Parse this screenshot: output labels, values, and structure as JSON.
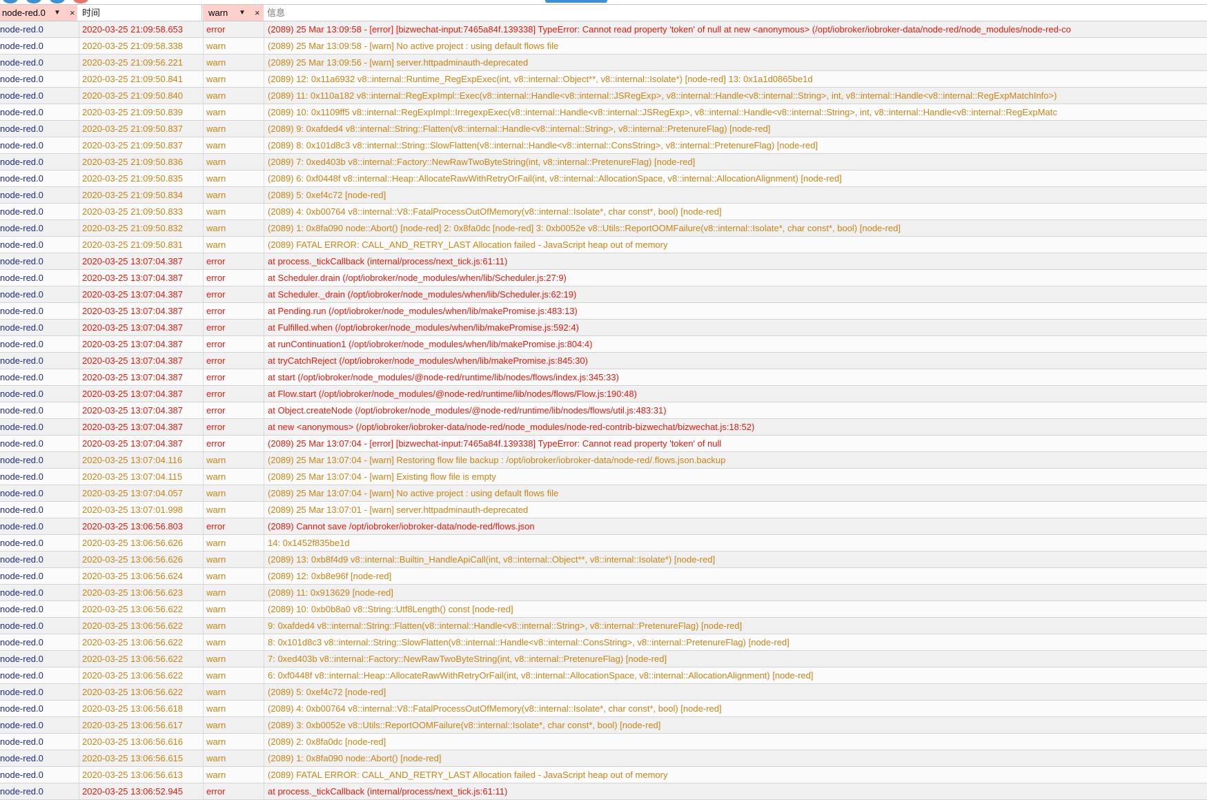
{
  "colors": {
    "warn": "#c98515",
    "error": "#e51b0e",
    "source": "#1f2a8a",
    "filter_bg": "#fdd0cc"
  },
  "filters": {
    "source": {
      "value": "node-red.0",
      "caret": "▼",
      "clear": "×"
    },
    "time": {
      "value": "时间"
    },
    "severity": {
      "value": "warn",
      "caret": "▼",
      "clear": "×"
    },
    "message": {
      "placeholder": "信息"
    }
  },
  "log_rows": [
    {
      "source": "node-red.0",
      "time": "2020-03-25 21:09:58.653",
      "severity": "error",
      "message": "(2089) 25 Mar 13:09:58 - [error] [bizwechat-input:7465a84f.139338] TypeError: Cannot read property 'token' of null at new <anonymous> (/opt/iobroker/iobroker-data/node-red/node_modules/node-red-co"
    },
    {
      "source": "node-red.0",
      "time": "2020-03-25 21:09:58.338",
      "severity": "warn",
      "message": "(2089) 25 Mar 13:09:58 - [warn] No active project : using default flows file"
    },
    {
      "source": "node-red.0",
      "time": "2020-03-25 21:09:56.221",
      "severity": "warn",
      "message": "(2089) 25 Mar 13:09:56 - [warn] server.httpadminauth-deprecated"
    },
    {
      "source": "node-red.0",
      "time": "2020-03-25 21:09:50.841",
      "severity": "warn",
      "message": "(2089) 12: 0x11a6932 v8::internal::Runtime_RegExpExec(int, v8::internal::Object**, v8::internal::Isolate*) [node-red] 13: 0x1a1d0865be1d"
    },
    {
      "source": "node-red.0",
      "time": "2020-03-25 21:09:50.840",
      "severity": "warn",
      "message": "(2089) 11: 0x110a182 v8::internal::RegExpImpl::Exec(v8::internal::Handle<v8::internal::JSRegExp>, v8::internal::Handle<v8::internal::String>, int, v8::internal::Handle<v8::internal::RegExpMatchInfo>)"
    },
    {
      "source": "node-red.0",
      "time": "2020-03-25 21:09:50.839",
      "severity": "warn",
      "message": "(2089) 10: 0x1109ff5 v8::internal::RegExpImpl::IrregexpExec(v8::internal::Handle<v8::internal::JSRegExp>, v8::internal::Handle<v8::internal::String>, int, v8::internal::Handle<v8::internal::RegExpMatc"
    },
    {
      "source": "node-red.0",
      "time": "2020-03-25 21:09:50.837",
      "severity": "warn",
      "message": "(2089) 9: 0xafded4 v8::internal::String::Flatten(v8::internal::Handle<v8::internal::String>, v8::internal::PretenureFlag) [node-red]"
    },
    {
      "source": "node-red.0",
      "time": "2020-03-25 21:09:50.837",
      "severity": "warn",
      "message": "(2089) 8: 0x101d8c3 v8::internal::String::SlowFlatten(v8::internal::Handle<v8::internal::ConsString>, v8::internal::PretenureFlag) [node-red]"
    },
    {
      "source": "node-red.0",
      "time": "2020-03-25 21:09:50.836",
      "severity": "warn",
      "message": "(2089) 7: 0xed403b v8::internal::Factory::NewRawTwoByteString(int, v8::internal::PretenureFlag) [node-red]"
    },
    {
      "source": "node-red.0",
      "time": "2020-03-25 21:09:50.835",
      "severity": "warn",
      "message": "(2089) 6: 0xf0448f v8::internal::Heap::AllocateRawWithRetryOrFail(int, v8::internal::AllocationSpace, v8::internal::AllocationAlignment) [node-red]"
    },
    {
      "source": "node-red.0",
      "time": "2020-03-25 21:09:50.834",
      "severity": "warn",
      "message": "(2089) 5: 0xef4c72 [node-red]"
    },
    {
      "source": "node-red.0",
      "time": "2020-03-25 21:09:50.833",
      "severity": "warn",
      "message": "(2089) 4: 0xb00764 v8::internal::V8::FatalProcessOutOfMemory(v8::internal::Isolate*, char const*, bool) [node-red]"
    },
    {
      "source": "node-red.0",
      "time": "2020-03-25 21:09:50.832",
      "severity": "warn",
      "message": "(2089) 1: 0x8fa090 node::Abort() [node-red] 2: 0x8fa0dc [node-red] 3: 0xb0052e v8::Utils::ReportOOMFailure(v8::internal::Isolate*, char const*, bool) [node-red]"
    },
    {
      "source": "node-red.0",
      "time": "2020-03-25 21:09:50.831",
      "severity": "warn",
      "message": "(2089) FATAL ERROR: CALL_AND_RETRY_LAST Allocation failed - JavaScript heap out of memory"
    },
    {
      "source": "node-red.0",
      "time": "2020-03-25 13:07:04.387",
      "severity": "error",
      "message": "at process._tickCallback (internal/process/next_tick.js:61:11)"
    },
    {
      "source": "node-red.0",
      "time": "2020-03-25 13:07:04.387",
      "severity": "error",
      "message": "at Scheduler.drain (/opt/iobroker/node_modules/when/lib/Scheduler.js:27:9)"
    },
    {
      "source": "node-red.0",
      "time": "2020-03-25 13:07:04.387",
      "severity": "error",
      "message": "at Scheduler._drain (/opt/iobroker/node_modules/when/lib/Scheduler.js:62:19)"
    },
    {
      "source": "node-red.0",
      "time": "2020-03-25 13:07:04.387",
      "severity": "error",
      "message": "at Pending.run (/opt/iobroker/node_modules/when/lib/makePromise.js:483:13)"
    },
    {
      "source": "node-red.0",
      "time": "2020-03-25 13:07:04.387",
      "severity": "error",
      "message": "at Fulfilled.when (/opt/iobroker/node_modules/when/lib/makePromise.js:592:4)"
    },
    {
      "source": "node-red.0",
      "time": "2020-03-25 13:07:04.387",
      "severity": "error",
      "message": "at runContinuation1 (/opt/iobroker/node_modules/when/lib/makePromise.js:804:4)"
    },
    {
      "source": "node-red.0",
      "time": "2020-03-25 13:07:04.387",
      "severity": "error",
      "message": "at tryCatchReject (/opt/iobroker/node_modules/when/lib/makePromise.js:845:30)"
    },
    {
      "source": "node-red.0",
      "time": "2020-03-25 13:07:04.387",
      "severity": "error",
      "message": "at start (/opt/iobroker/node_modules/@node-red/runtime/lib/nodes/flows/index.js:345:33)"
    },
    {
      "source": "node-red.0",
      "time": "2020-03-25 13:07:04.387",
      "severity": "error",
      "message": "at Flow.start (/opt/iobroker/node_modules/@node-red/runtime/lib/nodes/flows/Flow.js:190:48)"
    },
    {
      "source": "node-red.0",
      "time": "2020-03-25 13:07:04.387",
      "severity": "error",
      "message": "at Object.createNode (/opt/iobroker/node_modules/@node-red/runtime/lib/nodes/flows/util.js:483:31)"
    },
    {
      "source": "node-red.0",
      "time": "2020-03-25 13:07:04.387",
      "severity": "error",
      "message": "at new <anonymous> (/opt/iobroker/iobroker-data/node-red/node_modules/node-red-contrib-bizwechat/bizwechat.js:18:52)"
    },
    {
      "source": "node-red.0",
      "time": "2020-03-25 13:07:04.387",
      "severity": "error",
      "message": "(2089) 25 Mar 13:07:04 - [error] [bizwechat-input:7465a84f.139338] TypeError: Cannot read property 'token' of null"
    },
    {
      "source": "node-red.0",
      "time": "2020-03-25 13:07:04.116",
      "severity": "warn",
      "message": "(2089) 25 Mar 13:07:04 - [warn] Restoring flow file backup : /opt/iobroker/iobroker-data/node-red/.flows.json.backup"
    },
    {
      "source": "node-red.0",
      "time": "2020-03-25 13:07:04.115",
      "severity": "warn",
      "message": "(2089) 25 Mar 13:07:04 - [warn] Existing flow file is empty"
    },
    {
      "source": "node-red.0",
      "time": "2020-03-25 13:07:04.057",
      "severity": "warn",
      "message": "(2089) 25 Mar 13:07:04 - [warn] No active project : using default flows file"
    },
    {
      "source": "node-red.0",
      "time": "2020-03-25 13:07:01.998",
      "severity": "warn",
      "message": "(2089) 25 Mar 13:07:01 - [warn] server.httpadminauth-deprecated"
    },
    {
      "source": "node-red.0",
      "time": "2020-03-25 13:06:56.803",
      "severity": "error",
      "message": "(2089) Cannot save /opt/iobroker/iobroker-data/node-red/flows.json"
    },
    {
      "source": "node-red.0",
      "time": "2020-03-25 13:06:56.626",
      "severity": "warn",
      "message": "14: 0x1452f835be1d"
    },
    {
      "source": "node-red.0",
      "time": "2020-03-25 13:06:56.626",
      "severity": "warn",
      "message": "(2089) 13: 0xb8f4d9 v8::internal::Builtin_HandleApiCall(int, v8::internal::Object**, v8::internal::Isolate*) [node-red]"
    },
    {
      "source": "node-red.0",
      "time": "2020-03-25 13:06:56.624",
      "severity": "warn",
      "message": "(2089) 12: 0xb8e96f [node-red]"
    },
    {
      "source": "node-red.0",
      "time": "2020-03-25 13:06:56.623",
      "severity": "warn",
      "message": "(2089) 11: 0x913629 [node-red]"
    },
    {
      "source": "node-red.0",
      "time": "2020-03-25 13:06:56.622",
      "severity": "warn",
      "message": "(2089) 10: 0xb0b8a0 v8::String::Utf8Length() const [node-red]"
    },
    {
      "source": "node-red.0",
      "time": "2020-03-25 13:06:56.622",
      "severity": "warn",
      "message": "9: 0xafded4 v8::internal::String::Flatten(v8::internal::Handle<v8::internal::String>, v8::internal::PretenureFlag) [node-red]"
    },
    {
      "source": "node-red.0",
      "time": "2020-03-25 13:06:56.622",
      "severity": "warn",
      "message": "8: 0x101d8c3 v8::internal::String::SlowFlatten(v8::internal::Handle<v8::internal::ConsString>, v8::internal::PretenureFlag) [node-red]"
    },
    {
      "source": "node-red.0",
      "time": "2020-03-25 13:06:56.622",
      "severity": "warn",
      "message": "7: 0xed403b v8::internal::Factory::NewRawTwoByteString(int, v8::internal::PretenureFlag) [node-red]"
    },
    {
      "source": "node-red.0",
      "time": "2020-03-25 13:06:56.622",
      "severity": "warn",
      "message": "6: 0xf0448f v8::internal::Heap::AllocateRawWithRetryOrFail(int, v8::internal::AllocationSpace, v8::internal::AllocationAlignment) [node-red]"
    },
    {
      "source": "node-red.0",
      "time": "2020-03-25 13:06:56.622",
      "severity": "warn",
      "message": "(2089) 5: 0xef4c72 [node-red]"
    },
    {
      "source": "node-red.0",
      "time": "2020-03-25 13:06:56.618",
      "severity": "warn",
      "message": "(2089) 4: 0xb00764 v8::internal::V8::FatalProcessOutOfMemory(v8::internal::Isolate*, char const*, bool) [node-red]"
    },
    {
      "source": "node-red.0",
      "time": "2020-03-25 13:06:56.617",
      "severity": "warn",
      "message": "(2089) 3: 0xb0052e v8::Utils::ReportOOMFailure(v8::internal::Isolate*, char const*, bool) [node-red]"
    },
    {
      "source": "node-red.0",
      "time": "2020-03-25 13:06:56.616",
      "severity": "warn",
      "message": "(2089) 2: 0x8fa0dc [node-red]"
    },
    {
      "source": "node-red.0",
      "time": "2020-03-25 13:06:56.615",
      "severity": "warn",
      "message": "(2089) 1: 0x8fa090 node::Abort() [node-red]"
    },
    {
      "source": "node-red.0",
      "time": "2020-03-25 13:06:56.613",
      "severity": "warn",
      "message": "(2089) FATAL ERROR: CALL_AND_RETRY_LAST Allocation failed - JavaScript heap out of memory"
    },
    {
      "source": "node-red.0",
      "time": "2020-03-25 13:06:52.945",
      "severity": "error",
      "message": "at process._tickCallback (internal/process/next_tick.js:61:11)"
    }
  ]
}
